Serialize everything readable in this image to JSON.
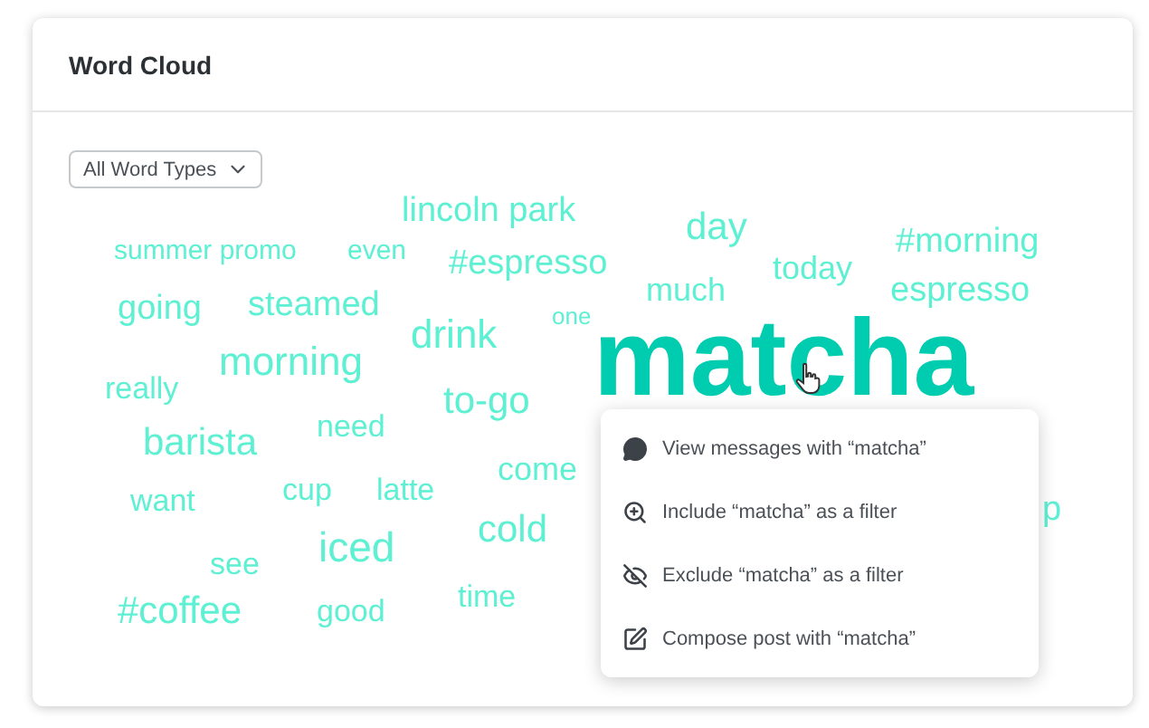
{
  "card": {
    "title": "Word Cloud"
  },
  "filter": {
    "value": "All Word Types"
  },
  "words": [
    {
      "text": "lincoln park",
      "selected": false
    },
    {
      "text": "summer promo",
      "selected": false
    },
    {
      "text": "even",
      "selected": false
    },
    {
      "text": "#espresso",
      "selected": false
    },
    {
      "text": "day",
      "selected": false
    },
    {
      "text": "today",
      "selected": false
    },
    {
      "text": "#morning",
      "selected": false
    },
    {
      "text": "much",
      "selected": false
    },
    {
      "text": "espresso",
      "selected": false
    },
    {
      "text": "going",
      "selected": false
    },
    {
      "text": "steamed",
      "selected": false
    },
    {
      "text": "one",
      "selected": false
    },
    {
      "text": "drink",
      "selected": false
    },
    {
      "text": "morning",
      "selected": false
    },
    {
      "text": "really",
      "selected": false
    },
    {
      "text": "to-go",
      "selected": false
    },
    {
      "text": "matcha",
      "selected": true
    },
    {
      "text": "barista",
      "selected": false
    },
    {
      "text": "need",
      "selected": false
    },
    {
      "text": "want",
      "selected": false
    },
    {
      "text": "cup",
      "selected": false
    },
    {
      "text": "latte",
      "selected": false
    },
    {
      "text": "come",
      "selected": false
    },
    {
      "text": "cold",
      "selected": false
    },
    {
      "text": "see",
      "selected": false
    },
    {
      "text": "iced",
      "selected": false
    },
    {
      "text": "#coffee",
      "selected": false
    },
    {
      "text": "good",
      "selected": false
    },
    {
      "text": "time",
      "selected": false
    },
    {
      "text": "p",
      "selected": false
    }
  ],
  "context_menu": [
    {
      "kind": "view",
      "label": "View messages with “matcha”"
    },
    {
      "kind": "include",
      "label": "Include “matcha” as a filter"
    },
    {
      "kind": "exclude",
      "label": "Exclude “matcha” as a filter"
    },
    {
      "kind": "compose",
      "label": "Compose post with “matcha”"
    }
  ]
}
